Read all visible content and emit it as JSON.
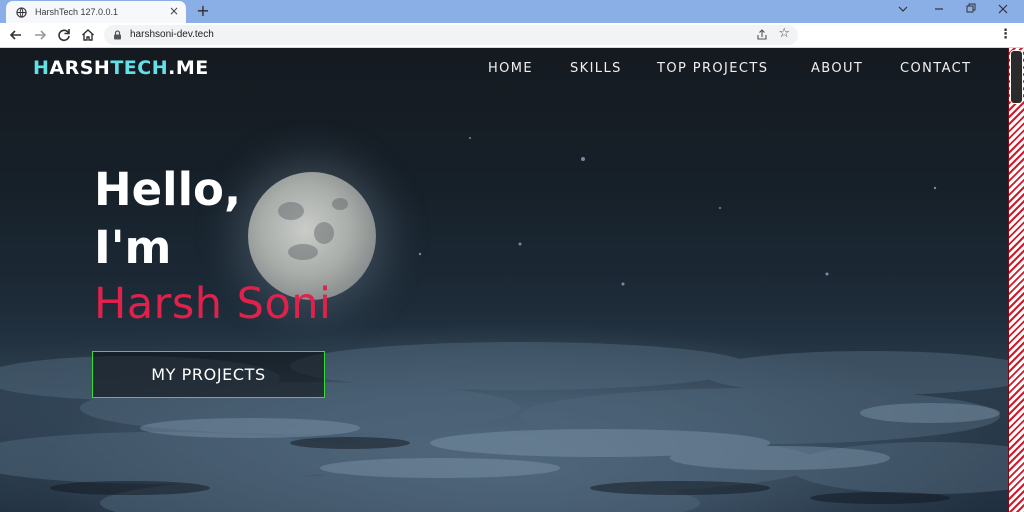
{
  "browser": {
    "tab_title": "HarshTech 127.0.0.1",
    "url": "harshsoni-dev.tech",
    "new_tab_symbol": "+",
    "close_tab_symbol": "×"
  },
  "site": {
    "logo": {
      "part1": "H",
      "part2": "ARSH",
      "part3": "TECH",
      "part4": ".ME"
    },
    "nav": [
      "HOME",
      "SKILLS",
      "TOP PROJECTS",
      "ABOUT",
      "CONTACT"
    ]
  },
  "hero": {
    "line1": "Hello,",
    "line2": "I'm",
    "name": "Harsh Soni",
    "button_label": "MY PROJECTS"
  },
  "colors": {
    "accent_cyan": "#63e1e8",
    "name_red": "#e0214c",
    "button_border": "#2fe02f",
    "tabstrip_blue": "#8aaee6"
  }
}
